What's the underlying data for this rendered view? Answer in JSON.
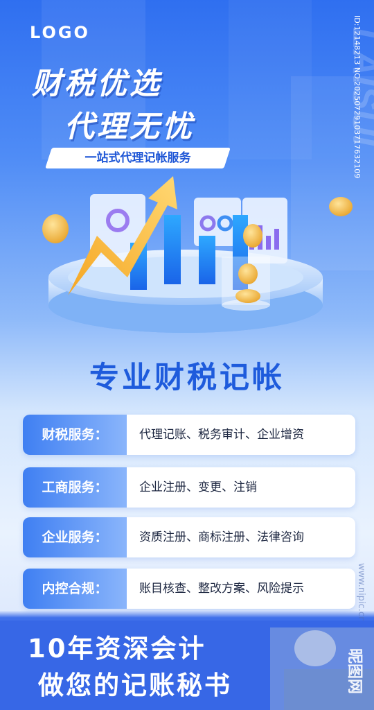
{
  "logo": "LOGO",
  "headline": {
    "line1": "财税优选",
    "line2": "代理无忧"
  },
  "subtitle": "一站式代理记帐服务",
  "watermark": {
    "side": "LAISUI",
    "id": "ID:12148213 NO:20250729103717632109",
    "site": "www.nipic.cn",
    "brand": "昵图网"
  },
  "main_heading": "专业财税记帐",
  "services": [
    {
      "label": "财税服务：",
      "value": "代理记账、税务审计、企业增资"
    },
    {
      "label": "工商服务：",
      "value": "企业注册、变更、注销"
    },
    {
      "label": "企业服务：",
      "value": "资质注册、商标注册、法律咨询"
    },
    {
      "label": "内控合规：",
      "value": "账目核查、整改方案、风险提示"
    }
  ],
  "footer": {
    "line1": "10年资深会计",
    "line2": "做您的记账秘书"
  },
  "colors": {
    "primary": "#1e5bdc",
    "label_start": "#3f7ff2",
    "label_end": "#8ab5fb",
    "arrow": "#f4b53a"
  }
}
